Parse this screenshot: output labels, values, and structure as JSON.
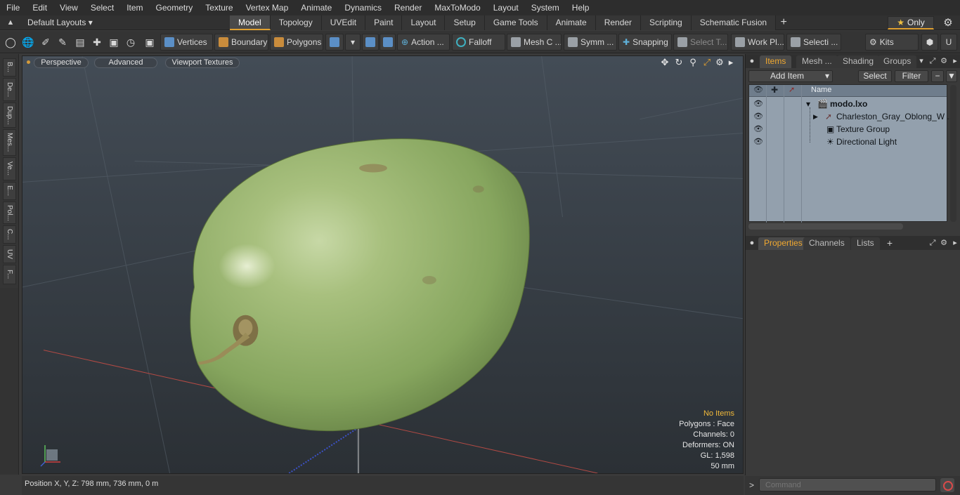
{
  "menu": [
    "File",
    "Edit",
    "View",
    "Select",
    "Item",
    "Geometry",
    "Texture",
    "Vertex Map",
    "Animate",
    "Dynamics",
    "Render",
    "MaxToModo",
    "Layout",
    "System",
    "Help"
  ],
  "layout": {
    "label": "Default Layouts ▾"
  },
  "tabs": [
    {
      "label": "Model",
      "active": true
    },
    {
      "label": "Topology"
    },
    {
      "label": "UVEdit"
    },
    {
      "label": "Paint"
    },
    {
      "label": "Layout"
    },
    {
      "label": "Setup"
    },
    {
      "label": "Game Tools"
    },
    {
      "label": "Animate"
    },
    {
      "label": "Render"
    },
    {
      "label": "Scripting"
    },
    {
      "label": "Schematic Fusion"
    }
  ],
  "tab_add": "+",
  "only_button": "Only",
  "toolbar": {
    "vertices": "Vertices",
    "boundary": "Boundary",
    "polygons": "Polygons",
    "action": "Action",
    "action_more": "...",
    "falloff": "Falloff",
    "mesh": "Mesh C ...",
    "symm": "Symm ...",
    "snapping": "Snapping",
    "select_t": "Select T...",
    "work_pl": "Work Pl...",
    "selecti": "Selecti ...",
    "kits": "Kits"
  },
  "left_tabs": [
    "B...",
    "De...",
    "Dup...",
    "Mes...",
    "Ve...",
    "E...",
    "Pol...",
    "C...",
    "UV",
    "F..."
  ],
  "viewport": {
    "perspective": "Perspective",
    "advanced": "Advanced",
    "textures": "Viewport Textures",
    "info": {
      "no_items": "No Items",
      "polygons": "Polygons : Face",
      "channels": "Channels: 0",
      "deformers": "Deformers: ON",
      "gl": "GL: 1,598",
      "focal": "50 mm"
    }
  },
  "items_panel": {
    "tabs": [
      "Items",
      "Mesh ...",
      "Shading",
      "Groups"
    ],
    "add_item": "Add Item",
    "select": "Select",
    "filter": "Filter",
    "col_name": "Name",
    "rows": [
      {
        "label": "modo.lxo"
      },
      {
        "label": "Charleston_Gray_Oblong_W ..."
      },
      {
        "label": "Texture Group"
      },
      {
        "label": "Directional Light"
      }
    ]
  },
  "props_panel": {
    "tabs": [
      "Properties",
      "Channels",
      "Lists"
    ],
    "add": "+"
  },
  "status": {
    "position": "Position X, Y, Z:  798 mm, 736 mm, 0 m"
  },
  "command": {
    "prompt": ">",
    "placeholder": "Command"
  },
  "colors": {
    "accent": "#e0a030",
    "viewport_top": "#3f4852",
    "viewport_bottom": "#2a2f34",
    "melon": "#8fb066"
  }
}
